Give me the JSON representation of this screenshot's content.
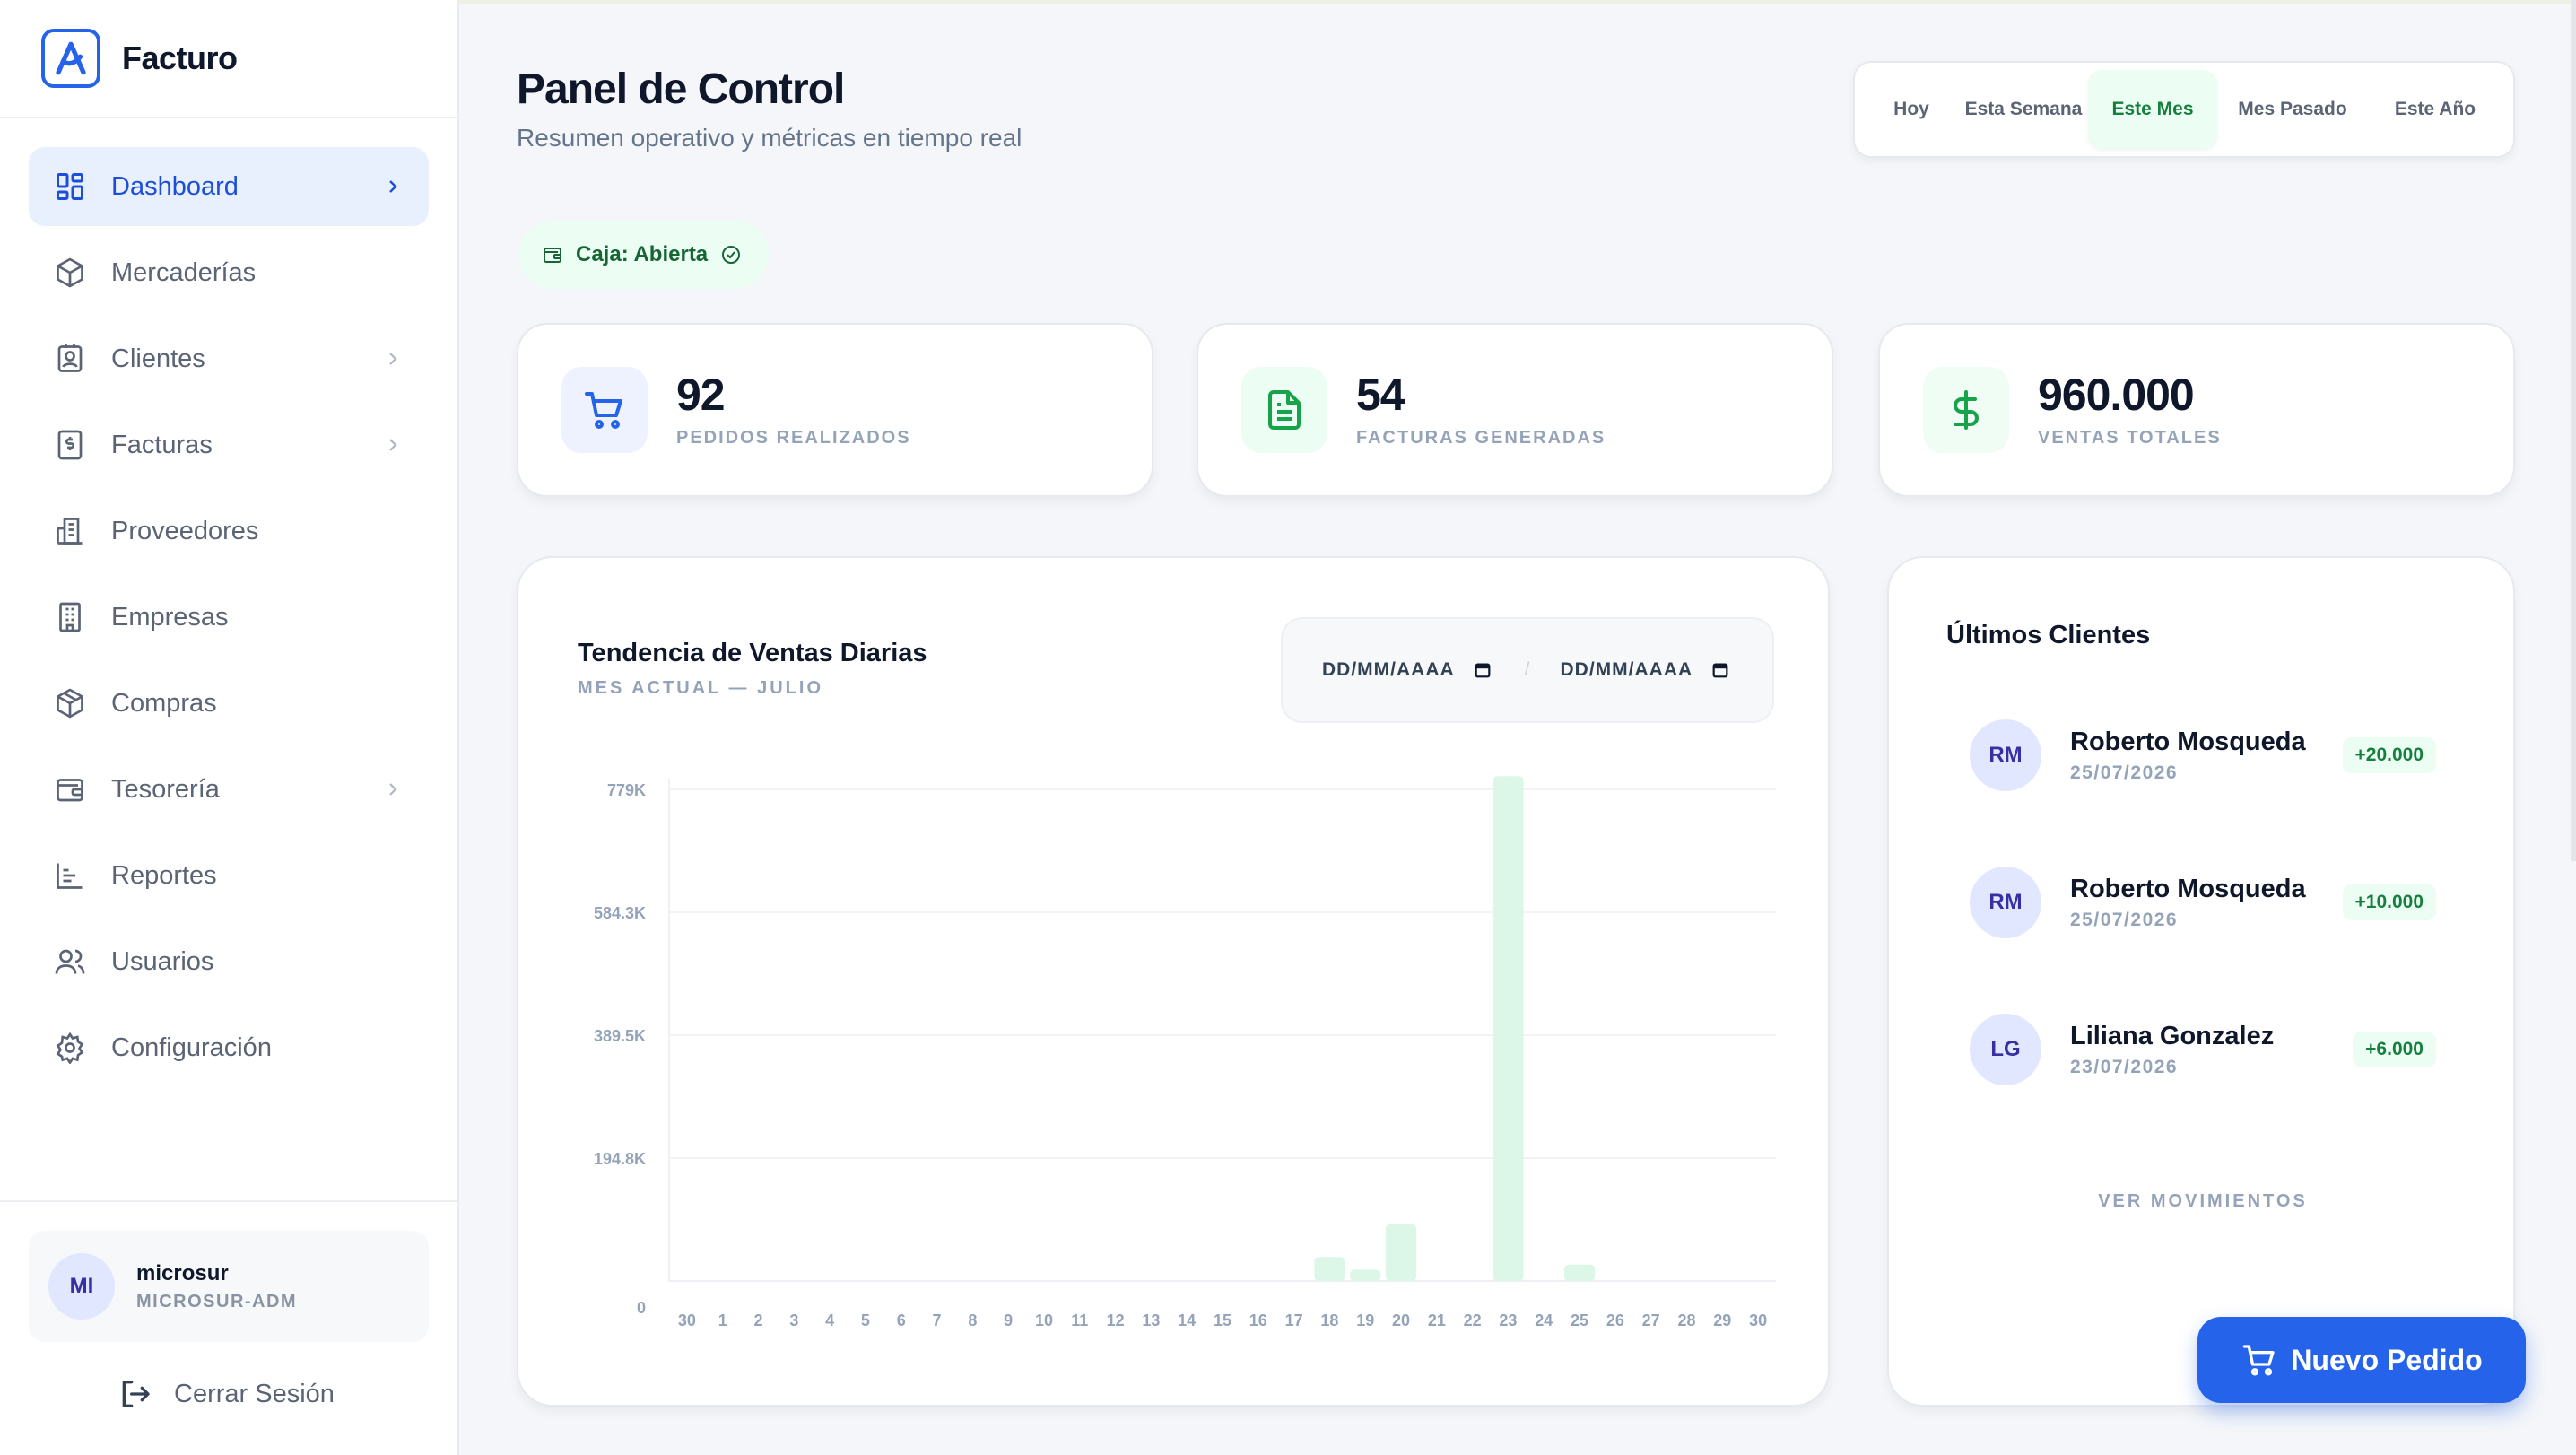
{
  "app": {
    "name": "Facturo",
    "accent": "#2563eb",
    "success": "#15803d"
  },
  "sidebar": {
    "items": [
      {
        "label": "Dashboard",
        "icon": "dashboard-icon",
        "active": true,
        "chevron": true
      },
      {
        "label": "Mercaderías",
        "icon": "box-icon",
        "active": false,
        "chevron": false
      },
      {
        "label": "Clientes",
        "icon": "contact-icon",
        "active": false,
        "chevron": true
      },
      {
        "label": "Facturas",
        "icon": "invoice-icon",
        "active": false,
        "chevron": true
      },
      {
        "label": "Proveedores",
        "icon": "building-icon",
        "active": false,
        "chevron": false
      },
      {
        "label": "Empresas",
        "icon": "office-icon",
        "active": false,
        "chevron": false
      },
      {
        "label": "Compras",
        "icon": "package-icon",
        "active": false,
        "chevron": false
      },
      {
        "label": "Tesorería",
        "icon": "wallet-icon",
        "active": false,
        "chevron": true
      },
      {
        "label": "Reportes",
        "icon": "report-icon",
        "active": false,
        "chevron": false
      },
      {
        "label": "Usuarios",
        "icon": "users-icon",
        "active": false,
        "chevron": false
      },
      {
        "label": "Configuración",
        "icon": "gear-icon",
        "active": false,
        "chevron": false
      }
    ],
    "user": {
      "initials": "MI",
      "name": "microsur",
      "role": "MICROSUR-ADM"
    },
    "logout_label": "Cerrar Sesión"
  },
  "header": {
    "title": "Panel de Control",
    "subtitle": "Resumen operativo y métricas en tiempo real",
    "ranges": [
      "Hoy",
      "Esta Semana",
      "Este Mes",
      "Mes Pasado",
      "Este Año"
    ],
    "active_range": "Este Mes"
  },
  "caja": {
    "label": "Caja: Abierta"
  },
  "stats": [
    {
      "value": "92",
      "label": "PEDIDOS REALIZADOS",
      "icon": "cart-icon",
      "color": "#2563eb",
      "bg": "#eef2ff"
    },
    {
      "value": "54",
      "label": "FACTURAS GENERADAS",
      "icon": "document-icon",
      "color": "#16a34a",
      "bg": "#ecfdf3"
    },
    {
      "value": "960.000",
      "label": "VENTAS TOTALES",
      "icon": "dollar-icon",
      "color": "#16a34a",
      "bg": "#f0fdf4"
    }
  ],
  "chart": {
    "title": "Tendencia de Ventas Diarias",
    "subtitle": "MES ACTUAL — JULIO",
    "date_from_placeholder": "DD/MM/AAAA",
    "date_to_placeholder": "DD/MM/AAAA",
    "separator": "/"
  },
  "chart_data": {
    "type": "bar",
    "categories": [
      "30",
      "1",
      "2",
      "3",
      "4",
      "5",
      "6",
      "7",
      "8",
      "9",
      "10",
      "11",
      "12",
      "13",
      "14",
      "15",
      "16",
      "17",
      "18",
      "19",
      "20",
      "21",
      "22",
      "23",
      "24",
      "25",
      "26",
      "27",
      "28",
      "29",
      "30"
    ],
    "values": [
      0,
      0,
      0,
      0,
      0,
      0,
      0,
      0,
      0,
      0,
      0,
      0,
      0,
      0,
      0,
      0,
      0,
      0,
      38000,
      18000,
      90000,
      0,
      0,
      800000,
      0,
      26000,
      0,
      0,
      0,
      0,
      0
    ],
    "yticks": [
      "0",
      "194.8K",
      "389.5K",
      "584.3K",
      "779K"
    ],
    "ylim": [
      0,
      779000
    ],
    "bar_color": "#dcf7e8",
    "grid": true
  },
  "clients": {
    "title": "Últimos Clientes",
    "items": [
      {
        "initials": "RM",
        "name": "Roberto Mosqueda",
        "date": "25/07/2026",
        "amount": "+20.000"
      },
      {
        "initials": "RM",
        "name": "Roberto Mosqueda",
        "date": "25/07/2026",
        "amount": "+10.000"
      },
      {
        "initials": "LG",
        "name": "Liliana Gonzalez",
        "date": "23/07/2026",
        "amount": "+6.000"
      }
    ],
    "see_more": "VER MOVIMIENTOS"
  },
  "fab": {
    "label": "Nuevo Pedido"
  }
}
